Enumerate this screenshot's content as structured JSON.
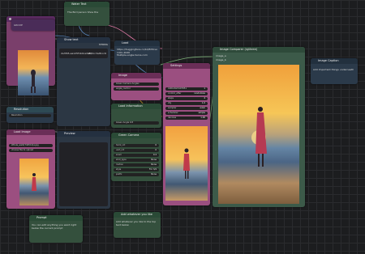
{
  "colors": {
    "pink": "#9b4f80",
    "pink_title": "#6a2e57",
    "green": "#34503d",
    "green_title": "#2a4a36",
    "slate": "#2b3a4a",
    "slate_title": "#22303e",
    "teal_title": "#2e4a54",
    "purple_title": "#5b2b61"
  },
  "nodes": {
    "water_text": {
      "title": "Water Text",
      "text": "The Bird person Shoe the"
    },
    "top_left": {
      "badge": "16",
      "sub": "ckpt"
    },
    "show_text": {
      "title": "Show text",
      "badge": "STRING",
      "value1": "2e3f45-aa1d5f1b9ce3e5.jpg",
      "value2": "#30cc3e81cc6"
    },
    "load_url": {
      "title": "Load",
      "text": "https://huggingface.co/bd/833cece-140c-2b66 Multiple.angle.heros.com"
    },
    "image_comparer": {
      "title": "Image Comparer (rgthree)",
      "badge": "image_a",
      "badge2": "image_b"
    },
    "image_caption": {
      "title": "Image Caption",
      "text": "Add Important things underneath"
    },
    "preview_bridge": {
      "title": "Preview Bridge",
      "badge": "16"
    },
    "middle_pink": {
      "title": "Image",
      "rows": [
        "Seed",
        "Steps",
        "CFG"
      ],
      "label": "Green Camera Angles",
      "label2": "MODEL",
      "label3": "angle_control"
    },
    "settings": {
      "title": "Settings",
      "rows": [
        {
          "k": "16814923407851",
          "v": "1"
        },
        {
          "k": "control_after",
          "v": "randomize"
        },
        {
          "k": "steps",
          "v": "4"
        },
        {
          "k": "cfg",
          "v": "1.0"
        },
        {
          "k": "sampler",
          "v": "euler"
        },
        {
          "k": "scheduler",
          "v": "simple"
        },
        {
          "k": "denoise",
          "v": "1.00"
        }
      ],
      "badge": "12"
    },
    "load_camera": {
      "title": "Load Information",
      "rows": [
        "Green Angle 0.8",
        "Green Camera"
      ],
      "rows2": [
        {
          "k": "horiz_rot",
          "v": "0"
        },
        {
          "k": "vert_rot",
          "v": "0"
        },
        {
          "k": "zoom",
          "v": "0.4"
        },
        {
          "k": "shot_type",
          "v": "None"
        },
        {
          "k": "motion",
          "v": "None"
        },
        {
          "k": "style",
          "v": "For 3/4"
        },
        {
          "k": "prefix",
          "v": "None"
        }
      ]
    },
    "resolution": {
      "title": "Resolution",
      "rows": [
        "Resolution",
        "Resolution"
      ]
    },
    "load_image": {
      "title": "Load Image",
      "row1": "Whole_walk(744512)a.jpg",
      "row2": "choose file to upload"
    },
    "preview": {
      "title": "Preview"
    },
    "prompt_node": {
      "title": "Prompt",
      "text": "You can edit anything you want right below the current prompt"
    },
    "add_node": {
      "title": "Add whatever you like",
      "text": "Add whatever you like to the top text below"
    },
    "node_badge_1": "GROUP",
    "node_badge_2": "STRING"
  },
  "icons": [
    "dot-icon",
    "collapse-icon"
  ]
}
